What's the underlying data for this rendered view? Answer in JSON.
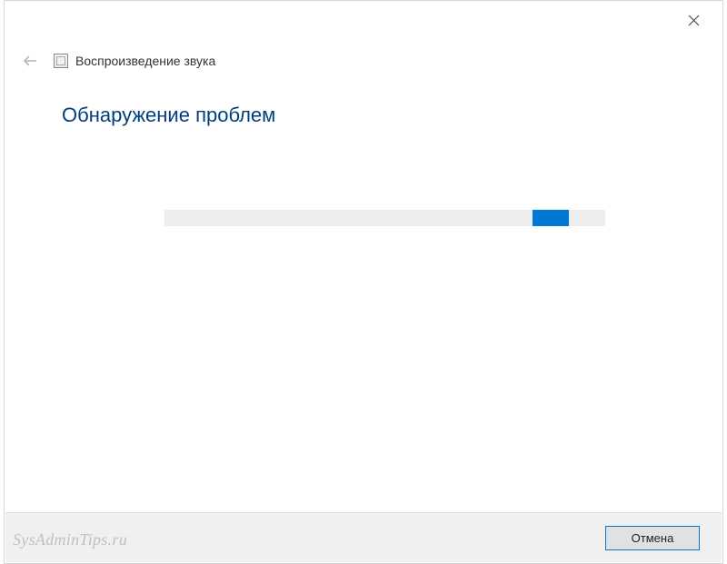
{
  "header": {
    "title": "Воспроизведение звука"
  },
  "main": {
    "heading": "Обнаружение проблем"
  },
  "progress": {
    "percent_offset": 83,
    "chunk_width_percent": 8
  },
  "footer": {
    "cancel_label": "Отмена"
  },
  "watermark": "SysAdminTips.ru"
}
